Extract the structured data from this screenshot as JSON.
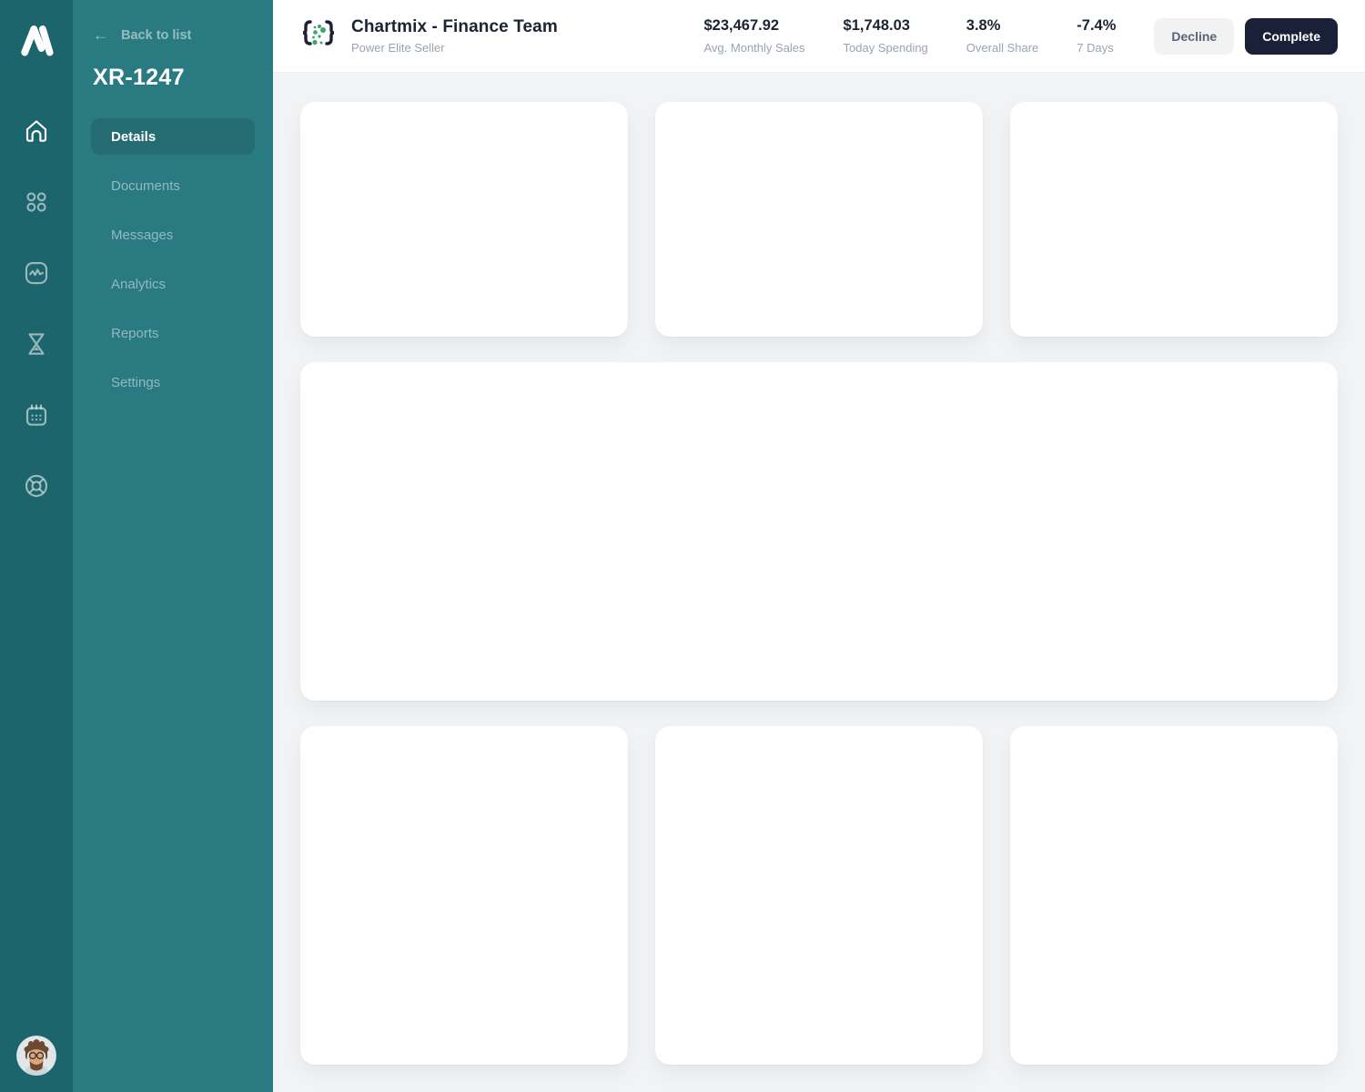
{
  "rail": {
    "logo_name": "app-logo",
    "icons": [
      {
        "name": "home-icon",
        "active": true
      },
      {
        "name": "apps-grid-icon",
        "active": false
      },
      {
        "name": "activity-chart-icon",
        "active": false
      },
      {
        "name": "hourglass-icon",
        "active": false
      },
      {
        "name": "calendar-icon",
        "active": false
      },
      {
        "name": "lifebuoy-help-icon",
        "active": false
      }
    ]
  },
  "sidebar": {
    "back_label": "Back to list",
    "back_icon": "arrow-left-icon",
    "back_arrow_glyph": "←",
    "case_id": "XR-1247",
    "items": [
      {
        "label": "Details",
        "active": true
      },
      {
        "label": "Documents",
        "active": false
      },
      {
        "label": "Messages",
        "active": false
      },
      {
        "label": "Analytics",
        "active": false
      },
      {
        "label": "Reports",
        "active": false
      },
      {
        "label": "Settings",
        "active": false
      }
    ]
  },
  "header": {
    "brand_icon": "braces-dots-logo",
    "title": "Chartmix - Finance Team",
    "subtitle": "Power Elite Seller",
    "stats": [
      {
        "value": "$23,467.92",
        "label": "Avg. Monthly Sales"
      },
      {
        "value": "$1,748.03",
        "label": "Today Spending"
      },
      {
        "value": "3.8%",
        "label": "Overall Share"
      },
      {
        "value": "-7.4%",
        "label": "7 Days"
      }
    ],
    "decline_label": "Decline",
    "complete_label": "Complete"
  },
  "content": {
    "cards": [
      "empty-card-1",
      "empty-card-2",
      "empty-card-3",
      "empty-wide-card",
      "empty-card-4",
      "empty-card-5",
      "empty-card-6"
    ]
  },
  "colors": {
    "rail_bg": "#1d656d",
    "sidebar_bg": "#2a7a82",
    "active_pill": "rgba(0,0,0,0.12)",
    "dark_navy": "#1a2038",
    "title_text": "#1c2433",
    "muted_text": "#9aa3b2",
    "green_dot": "#3da36f",
    "main_bg": "#f1f3f5",
    "card_bg": "#ffffff"
  }
}
